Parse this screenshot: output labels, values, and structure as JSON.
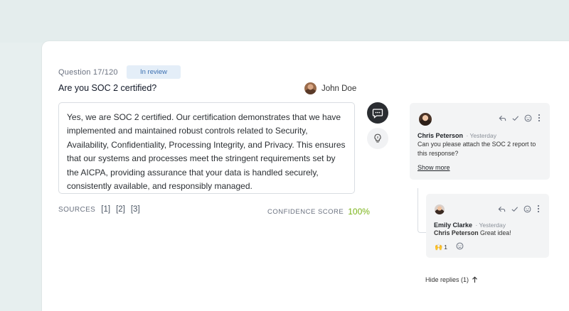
{
  "question": {
    "number_label": "Question 17/120",
    "status": "In review",
    "title": "Are you SOC 2 certified?",
    "assignee": "John Doe"
  },
  "answer": {
    "text": "Yes, we are SOC 2 certified. Our certification demonstrates that we have implemented and maintained robust controls related to Security, Availability, Confidentiality, Processing Integrity, and Privacy. This ensures that our systems and processes meet the stringent requirements set by the AICPA, providing assurance that your data is handled securely, consistently available, and responsibly managed."
  },
  "sources": {
    "label": "SOURCES",
    "links": [
      "[1]",
      "[2]",
      "[3]"
    ]
  },
  "confidence": {
    "label": "CONFIDENCE SCORE",
    "value": "100%"
  },
  "comments": [
    {
      "author": "Chris Peterson",
      "time": "· Yesterday",
      "text": "Can you please attach the SOC 2 report to this response?",
      "show_more": "Show more"
    },
    {
      "author": "Emily Clarke",
      "time": "· Yesterday",
      "mention": "Chris Peterson",
      "text": " Great idea!",
      "reaction_count": "1"
    }
  ],
  "hide_replies": "Hide replies (1)",
  "icons": {
    "comment": "comment-icon",
    "bulb": "lightbulb-icon",
    "reply": "reply-icon",
    "resolve": "check-icon",
    "emoji": "smiley-icon",
    "more": "more-vertical-icon",
    "arrow": "arrow-up-icon"
  },
  "colors": {
    "accent_green": "#7ab317",
    "badge_bg": "#e4eef8",
    "badge_text": "#3b6fb0"
  }
}
